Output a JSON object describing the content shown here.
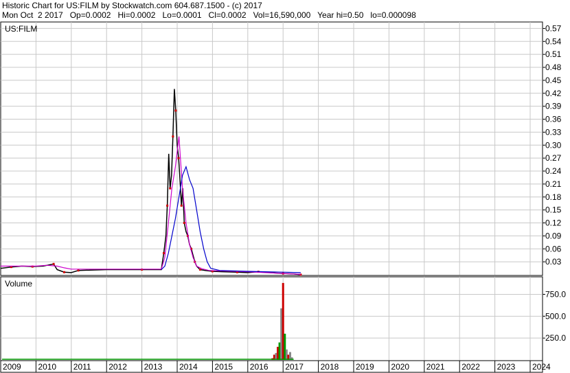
{
  "header": {
    "line1": "Historic Chart for US:FILM by Stockwatch.com 604.687.1500 - (c) 2017",
    "line2": "Mon Oct  2 2017   Op=0.0002   Hi=0.0002   Lo=0.0001   Cl=0.0002   Vol=16,590,000   Year hi=0.50   lo=0.000098"
  },
  "chart_data": {
    "type": "line",
    "symbol_label": "US:FILM",
    "volume_label": "Volume",
    "price_axis": {
      "min": 0,
      "max": 0.585,
      "ticks": [
        0.03,
        0.06,
        0.09,
        0.12,
        0.15,
        0.18,
        0.21,
        0.24,
        0.27,
        0.3,
        0.33,
        0.36,
        0.39,
        0.42,
        0.45,
        0.48,
        0.51,
        0.54,
        0.57
      ],
      "tick_labels": [
        "0.03",
        "0.06",
        "0.09",
        "0.12",
        "0.15",
        "0.18",
        "0.21",
        "0.24",
        "0.27",
        "0.30",
        "0.33",
        "0.36",
        "0.39",
        "0.42",
        "0.45",
        "0.48",
        "0.51",
        "0.54",
        "0.57"
      ]
    },
    "volume_axis": {
      "min": 0,
      "max": 950,
      "ticks": [
        250,
        500,
        750
      ],
      "tick_labels": [
        "250.0",
        "500.0",
        "750.0"
      ]
    },
    "x_axis": {
      "min": 2009.0,
      "max": 2024.35,
      "years": [
        2009,
        2010,
        2011,
        2012,
        2013,
        2014,
        2015,
        2016,
        2017,
        2018,
        2019,
        2020,
        2021,
        2022,
        2023,
        2024
      ],
      "year_labels": [
        "2009",
        "2010",
        "2011",
        "2012",
        "2013",
        "2014",
        "2015",
        "2016",
        "2017",
        "2018",
        "2019",
        "2020",
        "2021",
        "2022",
        "2023",
        "2024"
      ]
    },
    "grid": true,
    "colors": {
      "price": "#000000",
      "up": "#000000",
      "down": "#cc0000",
      "ma_short": "#cc00cc",
      "ma_long": "#0000cc",
      "volume_up": "#cc0000",
      "volume_down": "#888888",
      "volume_green": "#009900",
      "grid": "#c8c8c8"
    },
    "series": [
      {
        "name": "price",
        "x": [
          2009.0,
          2009.3,
          2009.6,
          2009.9,
          2010.2,
          2010.5,
          2010.6,
          2010.8,
          2011.0,
          2011.2,
          2012.0,
          2013.0,
          2013.55,
          2013.62,
          2013.68,
          2013.72,
          2013.76,
          2013.8,
          2013.84,
          2013.88,
          2013.92,
          2013.96,
          2014.0,
          2014.04,
          2014.08,
          2014.12,
          2014.16,
          2014.2,
          2014.25,
          2014.3,
          2014.35,
          2014.4,
          2014.45,
          2014.5,
          2014.55,
          2014.65,
          2014.8,
          2015.0,
          2015.3,
          2015.7,
          2016.0,
          2016.3,
          2016.8,
          2017.0,
          2017.3,
          2017.5
        ],
        "y": [
          0.015,
          0.018,
          0.02,
          0.019,
          0.02,
          0.025,
          0.012,
          0.006,
          0.005,
          0.01,
          0.012,
          0.012,
          0.012,
          0.05,
          0.09,
          0.16,
          0.28,
          0.2,
          0.23,
          0.32,
          0.43,
          0.38,
          0.3,
          0.27,
          0.22,
          0.16,
          0.2,
          0.12,
          0.1,
          0.09,
          0.07,
          0.06,
          0.045,
          0.03,
          0.02,
          0.012,
          0.01,
          0.008,
          0.007,
          0.006,
          0.005,
          0.007,
          0.004,
          0.003,
          0.002,
          0.0002
        ]
      },
      {
        "name": "ma_short",
        "x": [
          2009.0,
          2010.0,
          2010.3,
          2010.6,
          2010.8,
          2011.0,
          2013.55,
          2013.65,
          2013.75,
          2013.85,
          2013.95,
          2014.05,
          2014.15,
          2014.25,
          2014.35,
          2014.45,
          2014.55,
          2014.7,
          2014.9,
          2015.2,
          2016.0,
          2016.5,
          2017.0,
          2017.5
        ],
        "y": [
          0.02,
          0.02,
          0.022,
          0.02,
          0.016,
          0.013,
          0.013,
          0.04,
          0.12,
          0.2,
          0.25,
          0.32,
          0.2,
          0.12,
          0.07,
          0.04,
          0.02,
          0.014,
          0.01,
          0.009,
          0.007,
          0.005,
          0.003,
          0.001
        ]
      },
      {
        "name": "ma_long",
        "x": [
          2013.55,
          2013.65,
          2013.75,
          2013.85,
          2013.95,
          2014.05,
          2014.15,
          2014.25,
          2014.35,
          2014.45,
          2014.55,
          2014.65,
          2014.75,
          2014.85,
          2014.95,
          2015.2,
          2015.6,
          2016.0,
          2016.5,
          2017.0,
          2017.5
        ],
        "y": [
          0.012,
          0.02,
          0.05,
          0.09,
          0.13,
          0.18,
          0.23,
          0.25,
          0.22,
          0.2,
          0.15,
          0.1,
          0.06,
          0.03,
          0.015,
          0.01,
          0.009,
          0.008,
          0.007,
          0.006,
          0.005
        ]
      }
    ],
    "volume": {
      "x": [
        2016.7,
        2016.75,
        2016.8,
        2016.85,
        2016.9,
        2016.95,
        2017.0,
        2017.05,
        2017.1,
        2017.15,
        2017.2,
        2017.25
      ],
      "values": [
        20,
        60,
        80,
        150,
        200,
        590,
        880,
        300,
        120,
        60,
        90,
        30
      ],
      "colors": [
        "#cc0000",
        "#cc0000",
        "#888888",
        "#cc0000",
        "#009900",
        "#888888",
        "#cc0000",
        "#009900",
        "#888888",
        "#cc0000",
        "#888888",
        "#888888"
      ]
    }
  }
}
